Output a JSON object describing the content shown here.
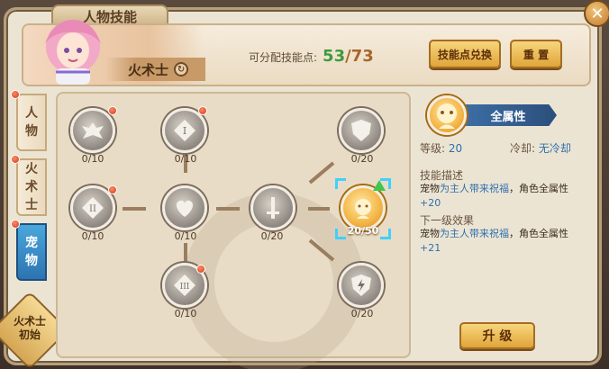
{
  "window": {
    "title": "人物技能"
  },
  "header": {
    "class_name": "火术士",
    "points_label": "可分配技能点:",
    "points_current": "53",
    "points_sep": "/",
    "points_max": "73",
    "exchange_button": "技能点兑换",
    "reset_button": "重 置"
  },
  "side_tabs": [
    {
      "label_1": "人",
      "label_2": "物",
      "selected": false
    },
    {
      "label_1": "火",
      "label_2": "术",
      "label_3": "士",
      "selected": false
    },
    {
      "label_1": "宠",
      "label_2": "物",
      "selected": true
    }
  ],
  "class_badge": {
    "line1": "火术士",
    "line2": "初始"
  },
  "tree": {
    "nodes": [
      {
        "id": "n1",
        "count": "0/10",
        "icon": "winged-crest-icon",
        "locked": true
      },
      {
        "id": "n2",
        "count": "0/10",
        "icon": "rank-one-icon",
        "locked": true
      },
      {
        "id": "n3",
        "count": "0/10",
        "icon": "rank-two-icon",
        "locked": true
      },
      {
        "id": "n4",
        "count": "0/10",
        "icon": "heart-icon",
        "locked": true
      },
      {
        "id": "n5",
        "count": "0/10",
        "icon": "rank-three-icon",
        "locked": true
      },
      {
        "id": "n6",
        "count": "0/20",
        "icon": "sword-icon",
        "locked": true
      },
      {
        "id": "n7",
        "count": "0/20",
        "icon": "shield-icon",
        "locked": true
      },
      {
        "id": "n8",
        "count": "20/50",
        "icon": "pet-face-icon",
        "locked": false
      },
      {
        "id": "n9",
        "count": "0/20",
        "icon": "lightning-shield-icon",
        "locked": true
      }
    ]
  },
  "detail": {
    "skill_name": "全属性",
    "level_label": "等级:",
    "level_value": "20",
    "cooldown_label": "冷却:",
    "cooldown_value": "无冷却",
    "desc_heading": "技能描述",
    "desc_pre": "宠物",
    "desc_hl": "为主人带来祝福",
    "desc_post": "，角色全属性",
    "desc_bonus": "+20",
    "next_heading": "下一级效果",
    "next_pre": "宠物",
    "next_hl": "为主人带来祝福",
    "next_post": "，角色全属性",
    "next_bonus": "+21",
    "upgrade_button": "升 级"
  },
  "colors": {
    "accent_green": "#3f9a3c",
    "accent_blue": "#2f6fae",
    "tab_active": "#2c74b1"
  }
}
